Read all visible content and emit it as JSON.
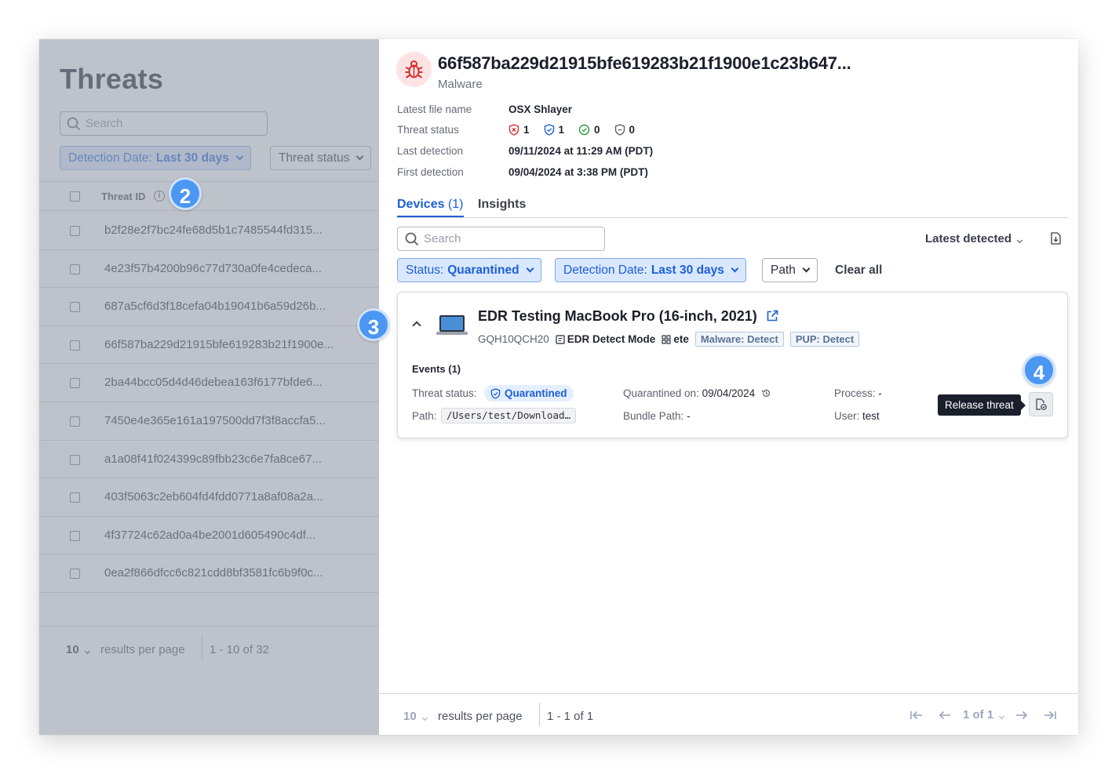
{
  "threats_panel": {
    "title": "Threats",
    "search_placeholder": "Search",
    "filters": {
      "detection_date_label": "Detection Date:",
      "detection_date_value": "Last 30 days",
      "threat_status_label": "Threat status"
    },
    "column_header": "Threat ID",
    "rows": [
      "b2f28e2f7bc24fe68d5b1c7485544fd315...",
      "4e23f57b4200b96c77d730a0fe4cedeca...",
      "687a5cf6d3f18cefa04b19041b6a59d26b...",
      "66f587ba229d21915bfe619283b21f1900e...",
      "2ba44bcc05d4d46debea163f6177bfde6...",
      "7450e4e365e161a197500dd7f3f8accfa5...",
      "a1a08f41f024399c89fbb23c6e7fa8ce67...",
      "403f5063c2eb604fd4fdd0771a8af08a2a...",
      "4f37724c62ad0a4be2001d605490c4df...",
      "0ea2f866dfcc6c821cdd8bf3581fc6b9f0c..."
    ],
    "footer": {
      "per_page": "10",
      "per_page_label": "results per page",
      "range": "1 - 10 of 32"
    }
  },
  "badges": {
    "b2": "2",
    "b3": "3",
    "b4": "4"
  },
  "detail": {
    "hash": "66f587ba229d21915bfe619283b21f1900e1c23b647...",
    "category": "Malware",
    "meta": {
      "latest_file_name_label": "Latest file name",
      "latest_file_name": "OSX Shlayer",
      "threat_status_label": "Threat status",
      "status_counts": [
        "1",
        "1",
        "0",
        "0"
      ],
      "last_detection_label": "Last detection",
      "last_detection": "09/11/2024 at 11:29 AM (PDT)",
      "first_detection_label": "First detection",
      "first_detection": "09/04/2024 at 3:38 PM (PDT)"
    },
    "tabs": {
      "devices_label": "Devices",
      "devices_count": "(1)",
      "insights_label": "Insights"
    },
    "search_placeholder": "Search",
    "sort_label": "Latest detected",
    "filters": {
      "status_label": "Status:",
      "status_value": "Quarantined",
      "detection_date_label": "Detection Date:",
      "detection_date_value": "Last 30 days",
      "path_label": "Path",
      "clear_all": "Clear all"
    },
    "device": {
      "name": "EDR Testing MacBook Pro (16-inch, 2021)",
      "serial": "GQH10QCH20",
      "mode": "EDR Detect Mode",
      "blueprint": "ete",
      "tags": [
        "Malware: Detect",
        "PUP: Detect"
      ],
      "events_label": "Events (1)",
      "threat_status_label": "Threat status:",
      "threat_status_value": "Quarantined",
      "path_label": "Path:",
      "path_value": "/Users/test/Download…",
      "quarantined_on_label": "Quarantined on:",
      "quarantined_on_value": "09/04/2024",
      "bundle_path_label": "Bundle Path:",
      "bundle_path_value": "-",
      "process_label": "Process:",
      "process_value": "-",
      "user_label": "User:",
      "user_value": "test",
      "release_tooltip": "Release threat"
    },
    "footer": {
      "per_page": "10",
      "per_page_label": "results per page",
      "range": "1 - 1 of 1",
      "page_indicator": "1 of 1"
    }
  }
}
